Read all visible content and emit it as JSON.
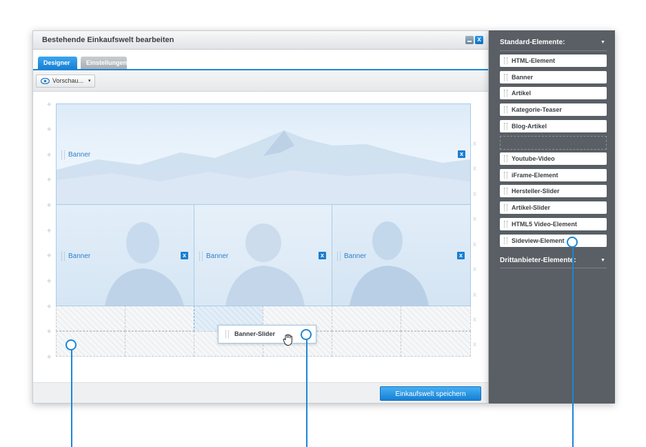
{
  "window": {
    "title": "Bestehende Einkaufswelt bearbeiten",
    "minimize_label": "_",
    "close_label": "x"
  },
  "tabs": [
    {
      "label": "Designer",
      "active": true
    },
    {
      "label": "Einstellungen",
      "active": false
    }
  ],
  "toolbar": {
    "preview_label": "Vorschau...",
    "preview_caret": "▾"
  },
  "canvas": {
    "banners": [
      {
        "label": "Banner"
      },
      {
        "label": "Banner"
      },
      {
        "label": "Banner"
      },
      {
        "label": "Banner"
      }
    ],
    "remove_label": "x",
    "row_remove_label": "x",
    "row_add_label": "+",
    "dragging_element": {
      "label": "Banner-Slider"
    }
  },
  "footer": {
    "save_label": "Einkaufswelt speichern"
  },
  "sidebar": {
    "standard_header": "Standard-Elemente:",
    "standard_items": [
      {
        "label": "HTML-Element"
      },
      {
        "label": "Banner"
      },
      {
        "label": "Artikel"
      },
      {
        "label": "Kategorie-Teaser"
      },
      {
        "label": "Blog-Artikel"
      },
      {
        "label": "Youtube-Video"
      },
      {
        "label": "iFrame-Element"
      },
      {
        "label": "Hersteller-Slider"
      },
      {
        "label": "Artikel-Slider"
      },
      {
        "label": "HTML5 Video-Element"
      },
      {
        "label": "Sideview-Element"
      }
    ],
    "third_party_header": "Drittanbieter-Elemente:",
    "caret": "▼"
  },
  "colors": {
    "accent": "#1d85d6",
    "sidebar_bg": "#595f64",
    "banner_text": "#2f7fc7"
  }
}
